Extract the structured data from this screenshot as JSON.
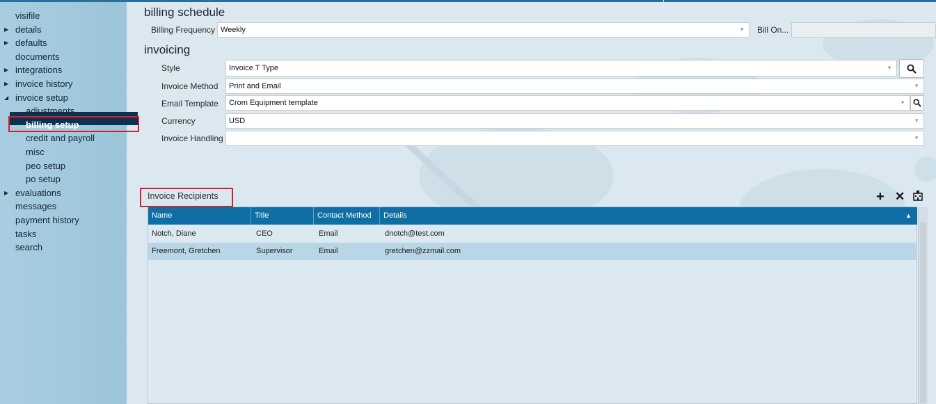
{
  "sidebar": {
    "items": [
      {
        "label": "visifile",
        "arrow": ""
      },
      {
        "label": "details",
        "arrow": "▶"
      },
      {
        "label": "defaults",
        "arrow": "▶"
      },
      {
        "label": "documents",
        "arrow": ""
      },
      {
        "label": "integrations",
        "arrow": "▶"
      },
      {
        "label": "invoice history",
        "arrow": "▶"
      },
      {
        "label": "invoice setup",
        "arrow": "◢"
      },
      {
        "label": "adjustments",
        "arrow": ""
      },
      {
        "label": "billing setup",
        "arrow": ""
      },
      {
        "label": "credit and payroll",
        "arrow": ""
      },
      {
        "label": "misc",
        "arrow": ""
      },
      {
        "label": "peo setup",
        "arrow": ""
      },
      {
        "label": "po setup",
        "arrow": ""
      },
      {
        "label": "evaluations",
        "arrow": "▶"
      },
      {
        "label": "messages",
        "arrow": ""
      },
      {
        "label": "payment history",
        "arrow": ""
      },
      {
        "label": "tasks",
        "arrow": ""
      },
      {
        "label": "search",
        "arrow": ""
      }
    ]
  },
  "billing_schedule": {
    "title": "billing schedule",
    "frequency_label": "Billing Frequency",
    "frequency_value": "Weekly",
    "bill_on_label": "Bill On...",
    "bill_on_value": ""
  },
  "invoicing": {
    "title": "invoicing",
    "style_label": "Style",
    "style_value": "Invoice T Type",
    "method_label": "Invoice Method",
    "method_value": "Print and Email",
    "email_template_label": "Email Template",
    "email_template_value": "Crom Equipment template",
    "currency_label": "Currency",
    "currency_value": "USD",
    "handling_label": "Invoice Handling",
    "handling_value": ""
  },
  "recipients": {
    "title": "Invoice Recipients",
    "columns": [
      "Name",
      "Title",
      "Contact Method",
      "Details"
    ],
    "rows": [
      [
        "Notch, Diane",
        "CEO",
        "Email",
        "dnotch@test.com"
      ],
      [
        "Freemont, Gretchen",
        "Supervisor",
        "Email",
        "gretchen@zzmail.com"
      ]
    ],
    "sort_indicator": "▲"
  },
  "colors": {
    "header_blue": "#0f6fa5",
    "selected_nav": "#0f3151",
    "highlight_red": "#d5202a",
    "selected_row": "#b8d6e6"
  },
  "icons": {
    "add": "add-icon",
    "delete": "delete-icon",
    "organization": "building-icon",
    "search": "search-icon"
  }
}
